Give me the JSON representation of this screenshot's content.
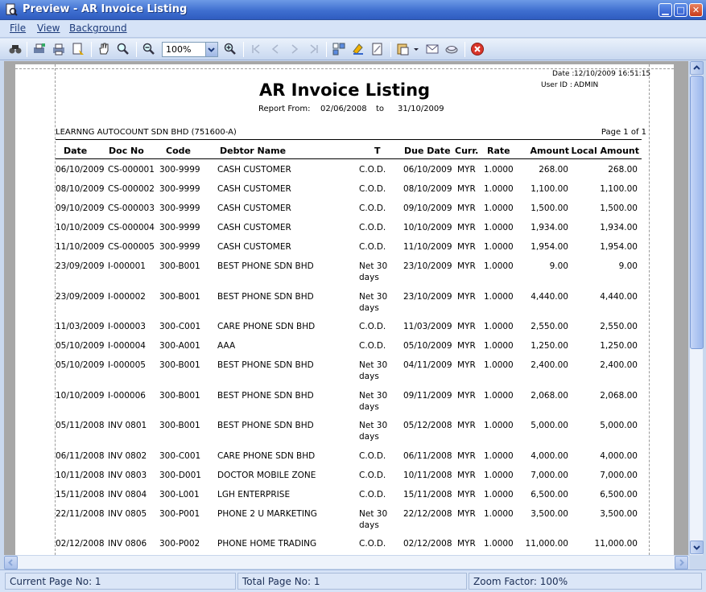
{
  "window": {
    "title": "Preview - AR Invoice Listing",
    "min_glyph": "▁",
    "max_glyph": "□",
    "close_glyph": "✕"
  },
  "menu": {
    "items": [
      {
        "label": "File"
      },
      {
        "label": "View"
      },
      {
        "label": "Background"
      }
    ]
  },
  "toolbar": {
    "zoom_value": "100%"
  },
  "report": {
    "title": "AR Invoice Listing",
    "from_label": "Report From:",
    "from_date": "02/06/2008",
    "to_label": "to",
    "to_date": "31/10/2009",
    "date_label": "Date :",
    "date_value": "12/10/2009 16:51:15",
    "user_label": "User ID :",
    "user_value": "ADMIN",
    "company": "LEARNNG AUTOCOUNT SDN BHD (751600-A)",
    "page_of": "Page 1 of 1",
    "columns": [
      "Date",
      "Doc No",
      "Code",
      "Debtor Name",
      "T",
      "Due Date",
      "Curr.",
      "Rate",
      "Amount",
      "Local Amount"
    ],
    "rows": [
      [
        "06/10/2009",
        "CS-000001",
        "300-9999",
        "CASH CUSTOMER",
        "C.O.D.",
        "06/10/2009",
        "MYR",
        "1.0000",
        "268.00",
        "268.00"
      ],
      [
        "08/10/2009",
        "CS-000002",
        "300-9999",
        "CASH CUSTOMER",
        "C.O.D.",
        "08/10/2009",
        "MYR",
        "1.0000",
        "1,100.00",
        "1,100.00"
      ],
      [
        "09/10/2009",
        "CS-000003",
        "300-9999",
        "CASH CUSTOMER",
        "C.O.D.",
        "09/10/2009",
        "MYR",
        "1.0000",
        "1,500.00",
        "1,500.00"
      ],
      [
        "10/10/2009",
        "CS-000004",
        "300-9999",
        "CASH CUSTOMER",
        "C.O.D.",
        "10/10/2009",
        "MYR",
        "1.0000",
        "1,934.00",
        "1,934.00"
      ],
      [
        "11/10/2009",
        "CS-000005",
        "300-9999",
        "CASH CUSTOMER",
        "C.O.D.",
        "11/10/2009",
        "MYR",
        "1.0000",
        "1,954.00",
        "1,954.00"
      ],
      [
        "23/09/2009",
        "I-000001",
        "300-B001",
        "BEST PHONE SDN BHD",
        "Net 30 days",
        "23/10/2009",
        "MYR",
        "1.0000",
        "9.00",
        "9.00"
      ],
      [
        "23/09/2009",
        "I-000002",
        "300-B001",
        "BEST PHONE SDN BHD",
        "Net 30 days",
        "23/10/2009",
        "MYR",
        "1.0000",
        "4,440.00",
        "4,440.00"
      ],
      [
        "11/03/2009",
        "I-000003",
        "300-C001",
        "CARE PHONE SDN BHD",
        "C.O.D.",
        "11/03/2009",
        "MYR",
        "1.0000",
        "2,550.00",
        "2,550.00"
      ],
      [
        "05/10/2009",
        "I-000004",
        "300-A001",
        "AAA",
        "C.O.D.",
        "05/10/2009",
        "MYR",
        "1.0000",
        "1,250.00",
        "1,250.00"
      ],
      [
        "05/10/2009",
        "I-000005",
        "300-B001",
        "BEST PHONE SDN BHD",
        "Net 30 days",
        "04/11/2009",
        "MYR",
        "1.0000",
        "2,400.00",
        "2,400.00"
      ],
      [
        "10/10/2009",
        "I-000006",
        "300-B001",
        "BEST PHONE SDN BHD",
        "Net 30 days",
        "09/11/2009",
        "MYR",
        "1.0000",
        "2,068.00",
        "2,068.00"
      ],
      [
        "05/11/2008",
        "INV 0801",
        "300-B001",
        "BEST PHONE SDN BHD",
        "Net 30 days",
        "05/12/2008",
        "MYR",
        "1.0000",
        "5,000.00",
        "5,000.00"
      ],
      [
        "06/11/2008",
        "INV 0802",
        "300-C001",
        "CARE PHONE SDN BHD",
        "C.O.D.",
        "06/11/2008",
        "MYR",
        "1.0000",
        "4,000.00",
        "4,000.00"
      ],
      [
        "10/11/2008",
        "INV 0803",
        "300-D001",
        "DOCTOR MOBILE ZONE",
        "C.O.D.",
        "10/11/2008",
        "MYR",
        "1.0000",
        "7,000.00",
        "7,000.00"
      ],
      [
        "15/11/2008",
        "INV 0804",
        "300-L001",
        "LGH ENTERPRISE",
        "C.O.D.",
        "15/11/2008",
        "MYR",
        "1.0000",
        "6,500.00",
        "6,500.00"
      ],
      [
        "22/11/2008",
        "INV 0805",
        "300-P001",
        "PHONE 2 U MARKETING",
        "Net 30 days",
        "22/12/2008",
        "MYR",
        "1.0000",
        "3,500.00",
        "3,500.00"
      ],
      [
        "02/12/2008",
        "INV 0806",
        "300-P002",
        "PHONE HOME TRADING",
        "C.O.D.",
        "02/12/2008",
        "MYR",
        "1.0000",
        "11,000.00",
        "11,000.00"
      ]
    ]
  },
  "status": {
    "current_page": "Current Page No: 1",
    "total_page": "Total Page No: 1",
    "zoom_factor": "Zoom Factor: 100%"
  },
  "colors": {
    "titlebar": "#3f6fd0",
    "menubar": "#d6e3f7",
    "preview_bg": "#a7a7a7"
  }
}
